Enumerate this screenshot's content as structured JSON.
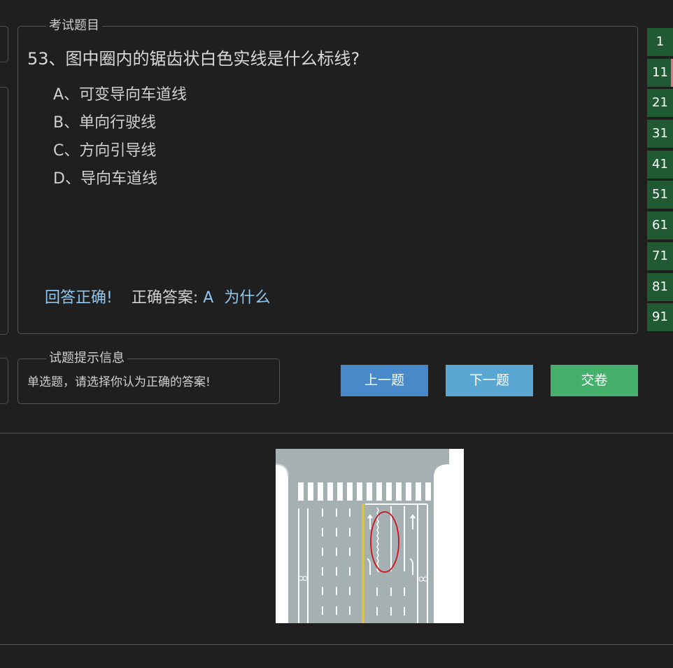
{
  "question_group": {
    "legend": "考试题目",
    "title": "53、图中圈内的锯齿状白色实线是什么标线?",
    "options": [
      {
        "label": "A、可变导向车道线"
      },
      {
        "label": "B、单向行驶线"
      },
      {
        "label": "C、方向引导线"
      },
      {
        "label": "D、导向车道线"
      }
    ],
    "result": {
      "status": "回答正确!",
      "answer_label": "正确答案:",
      "answer_value": "A",
      "why_link": "为什么"
    }
  },
  "hint_group": {
    "legend": "试题提示信息",
    "text": "单选题，请选择你认为正确的答案!"
  },
  "buttons": {
    "prev": "上一题",
    "next": "下一题",
    "submit": "交卷"
  },
  "number_nav": [
    "1",
    "11",
    "21",
    "31",
    "41",
    "51",
    "61",
    "71",
    "81",
    "91"
  ],
  "number_nav_current_index": 1,
  "colors": {
    "background": "#1f1f1f",
    "nav_green": "#1f5a32",
    "prev_blue": "#4a89c9",
    "next_blue": "#5ba7d3",
    "submit_green": "#45b06c",
    "answer_highlight": "#8ec8f0"
  }
}
